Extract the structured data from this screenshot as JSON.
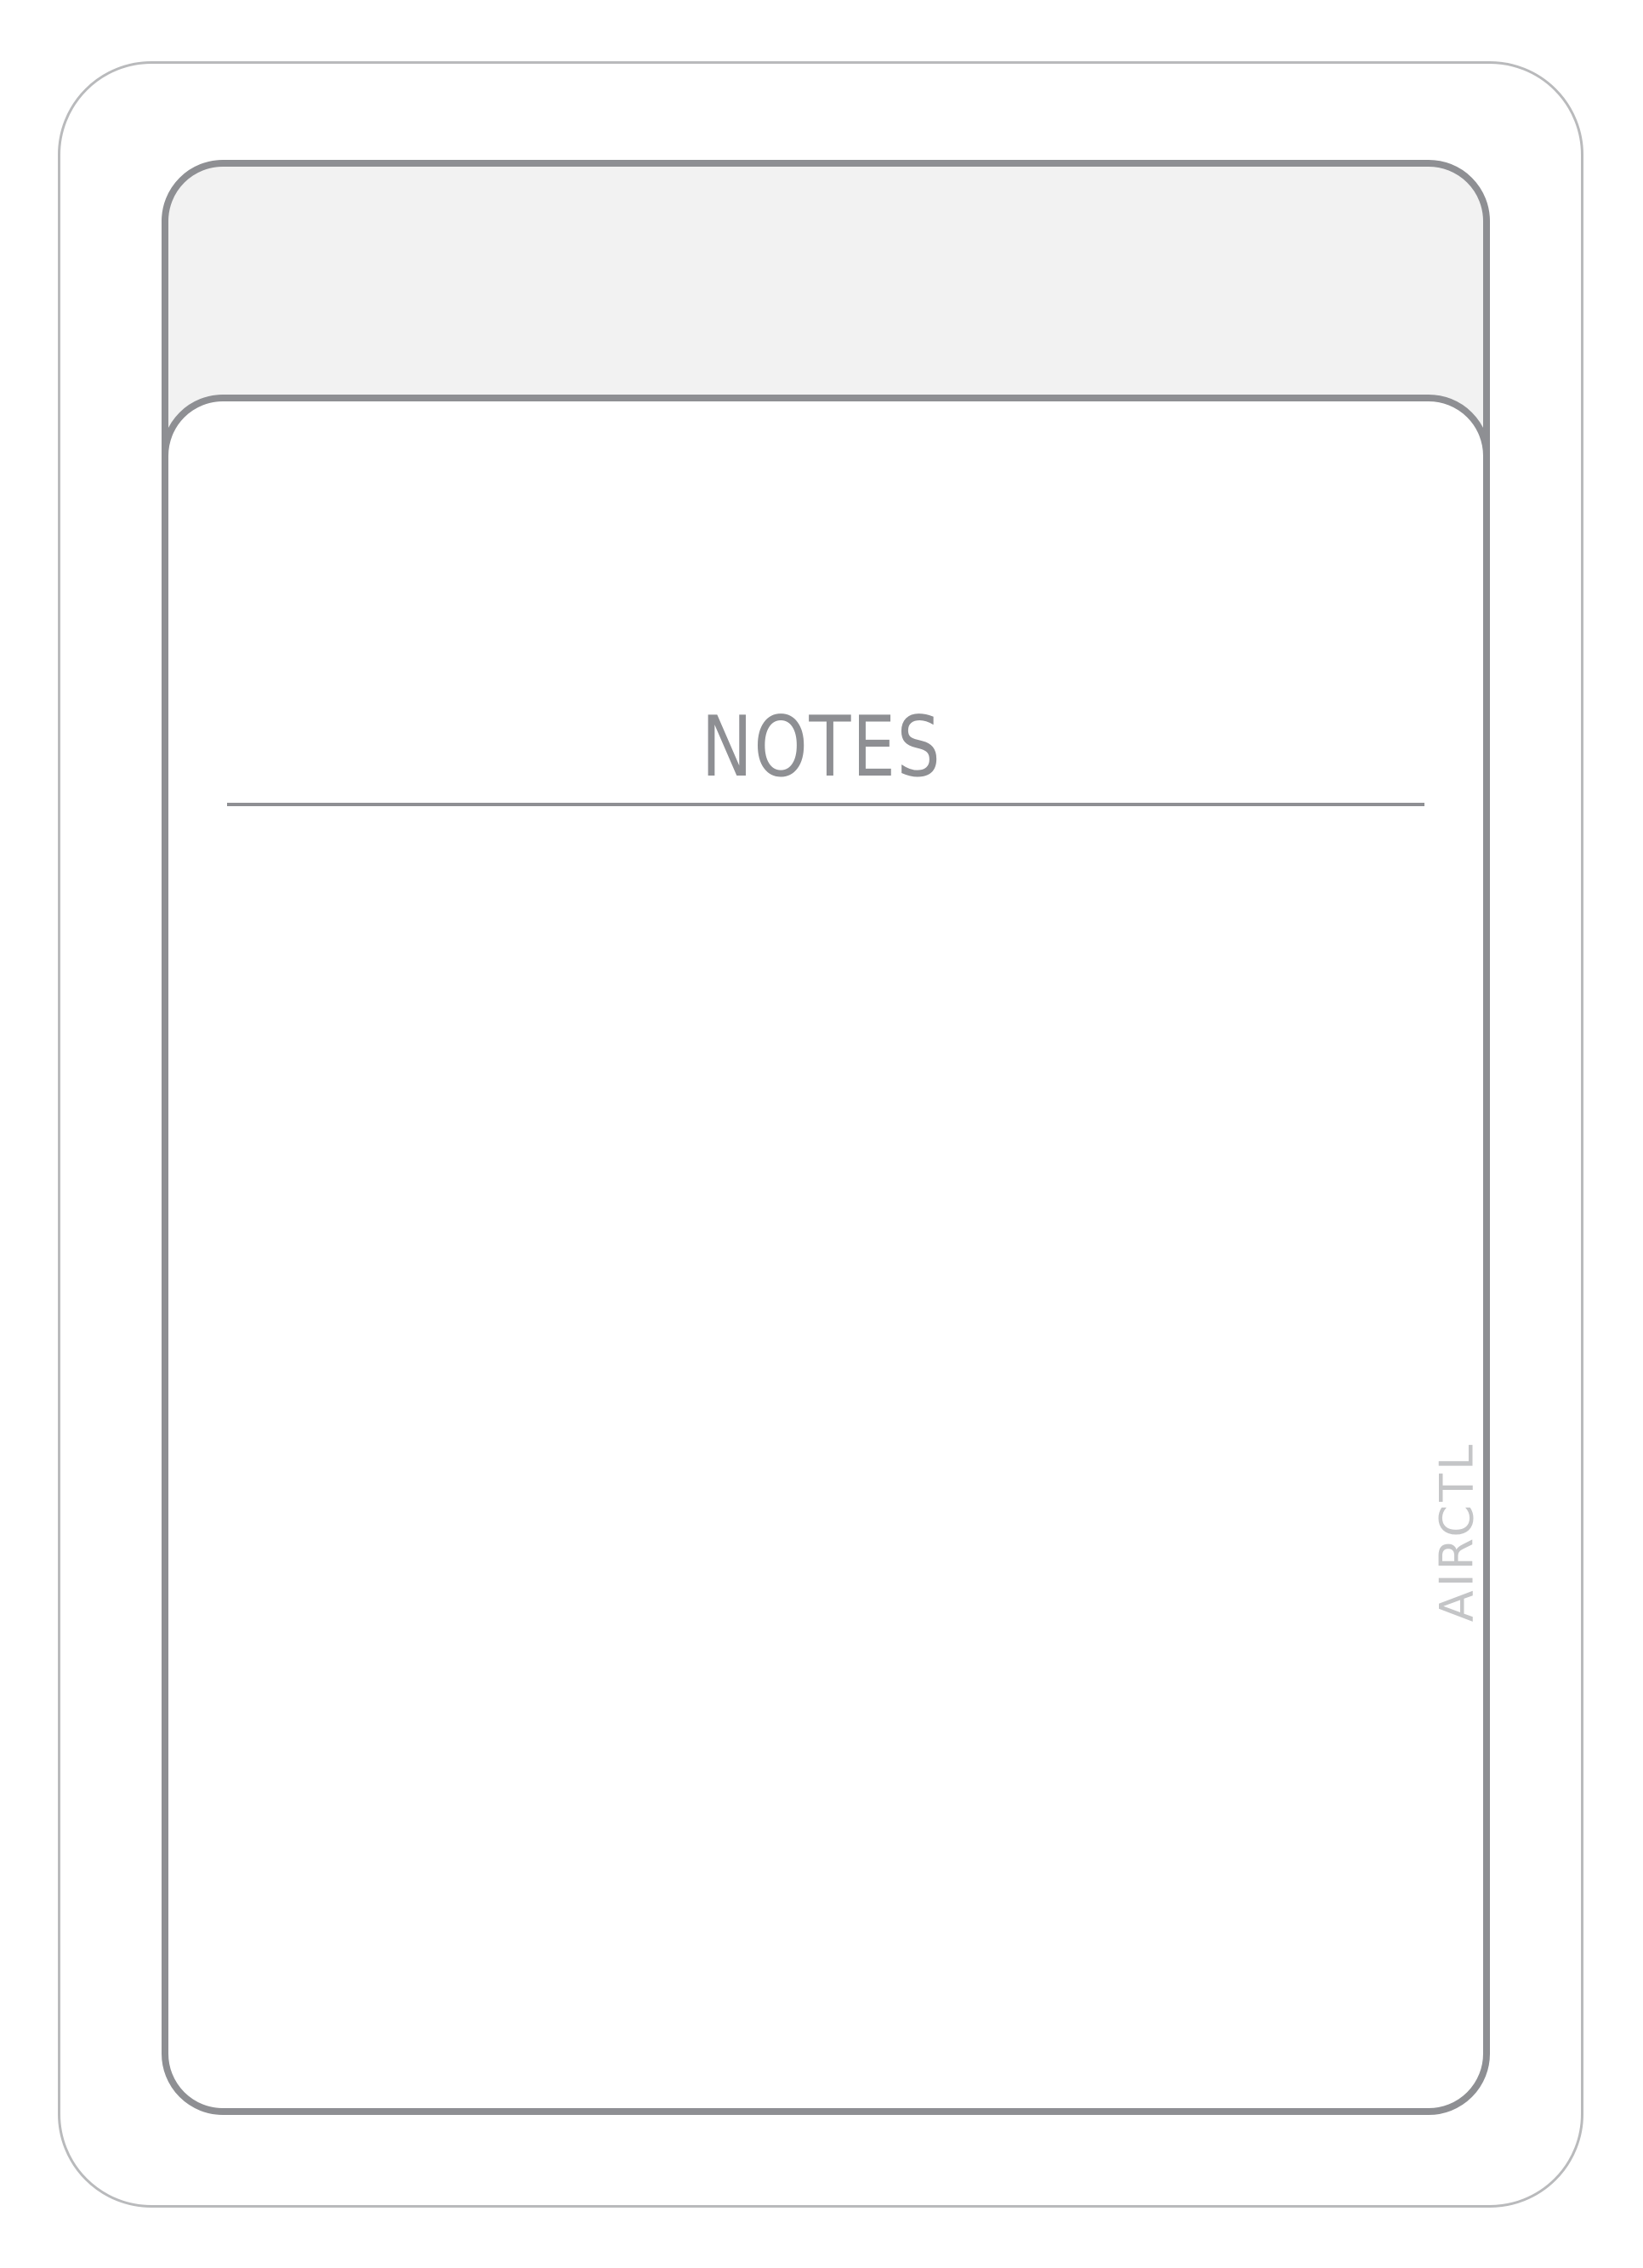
{
  "title": "NOTES",
  "brand": "AIRCTL",
  "colors": {
    "panel_border": "#8e8f93",
    "header_fill": "#f2f2f2",
    "outer_outline": "#b9babc",
    "brand_text": "#c4c5c7"
  }
}
